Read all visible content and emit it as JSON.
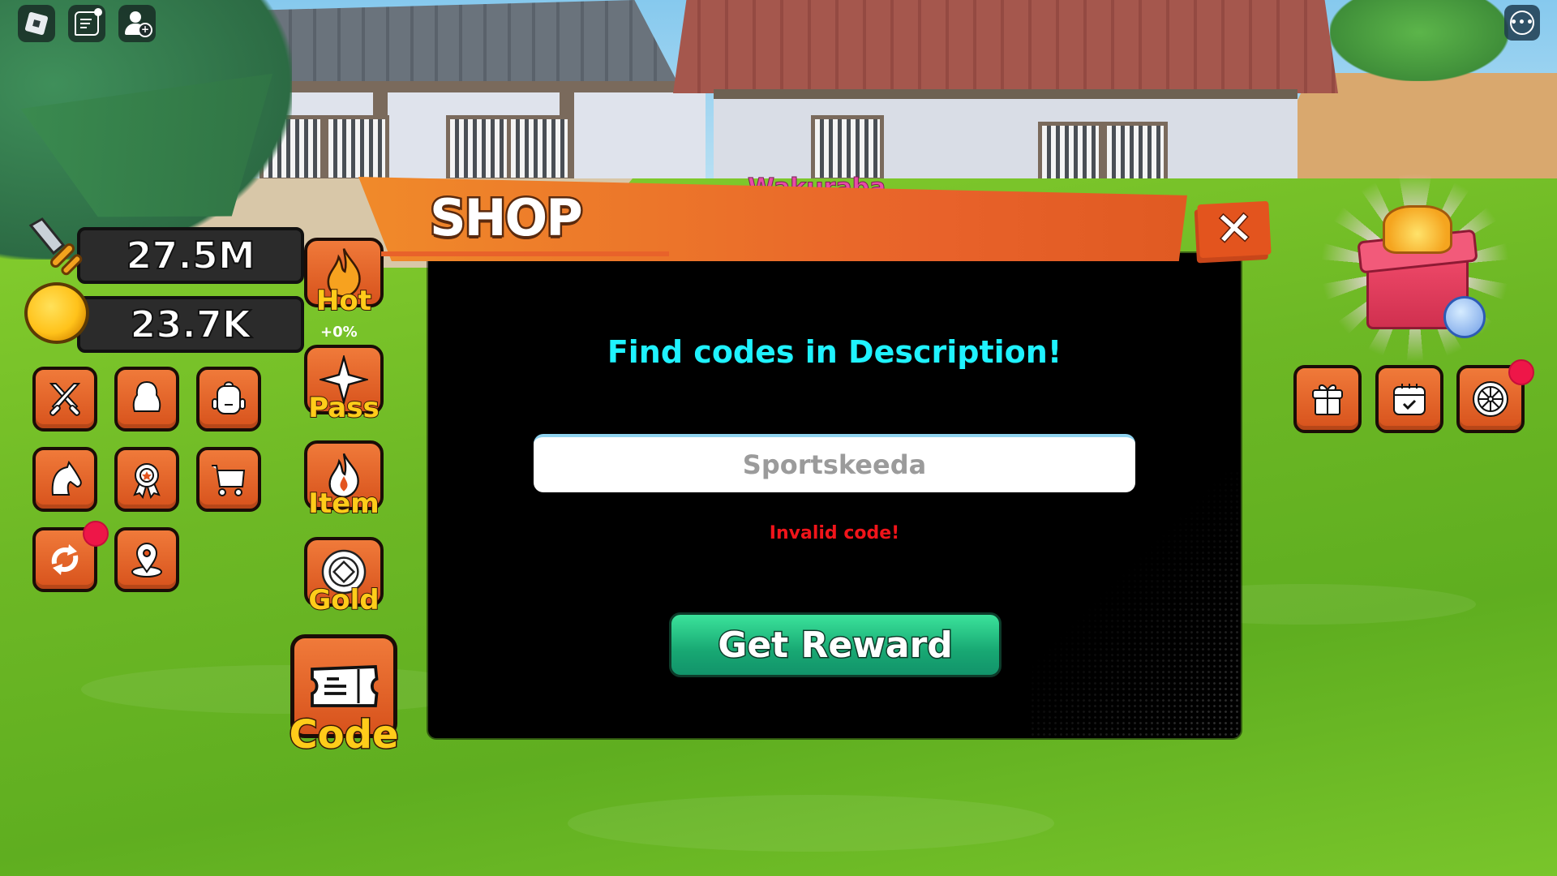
{
  "roblox_topbar": {
    "left_buttons": [
      {
        "name": "roblox-menu",
        "icon": "roblox-logo-icon"
      },
      {
        "name": "chat",
        "icon": "chat-icon"
      },
      {
        "name": "add-friend",
        "icon": "add-person-icon"
      }
    ],
    "right_button": {
      "name": "more-options",
      "icon": "ellipsis-icon",
      "glyph": "•••"
    }
  },
  "scene": {
    "npc_name": "Wakuraba"
  },
  "stats": {
    "power": {
      "icon": "sword-icon",
      "value": "27.5M"
    },
    "gold": {
      "icon": "coin-icon",
      "value": "23.7K"
    }
  },
  "left_menu": [
    {
      "name": "battle",
      "icon": "crossed-swords-icon",
      "notification": false
    },
    {
      "name": "characters",
      "icon": "character-silhouette-icon",
      "notification": false
    },
    {
      "name": "inventory",
      "icon": "backpack-icon",
      "notification": false
    },
    {
      "name": "mounts",
      "icon": "horse-icon",
      "notification": false
    },
    {
      "name": "achievements",
      "icon": "award-ribbon-icon",
      "notification": false
    },
    {
      "name": "store",
      "icon": "shopping-cart-icon",
      "notification": false
    },
    {
      "name": "rebirth",
      "icon": "refresh-arrows-icon",
      "notification": true
    },
    {
      "name": "teleport",
      "icon": "map-pin-icon",
      "notification": false
    }
  ],
  "shop_tabs": [
    {
      "label": "Hot",
      "icon": "flame-icon",
      "sub": "+0%"
    },
    {
      "label": "Pass",
      "icon": "four-point-star-icon"
    },
    {
      "label": "Item",
      "icon": "white-flame-icon"
    },
    {
      "label": "Gold",
      "icon": "gold-coin-icon"
    },
    {
      "label": "Code",
      "icon": "ticket-icon"
    }
  ],
  "shop": {
    "title": "SHOP",
    "close_glyph": "✕",
    "hint": "Find codes in Description!",
    "code_input_value": "",
    "code_input_placeholder": "Sportskeeda",
    "error_message": "Invalid code!",
    "submit_label": "Get Reward"
  },
  "right_menu": [
    {
      "name": "gifts",
      "icon": "gift-icon",
      "notification": false
    },
    {
      "name": "daily-rewards",
      "icon": "calendar-check-icon",
      "notification": false
    },
    {
      "name": "spin-wheel",
      "icon": "wheel-icon",
      "notification": true
    }
  ],
  "timed_gift": {
    "icon": "timed-gift-box-icon"
  },
  "colors": {
    "button_orange": "#e3621f",
    "tab_label_yellow": "#ffcc1a",
    "hint_cyan": "#1ff2ff",
    "error_red": "#f0141a",
    "reward_green": "#1fb87c",
    "notification_red": "#ee1648"
  }
}
